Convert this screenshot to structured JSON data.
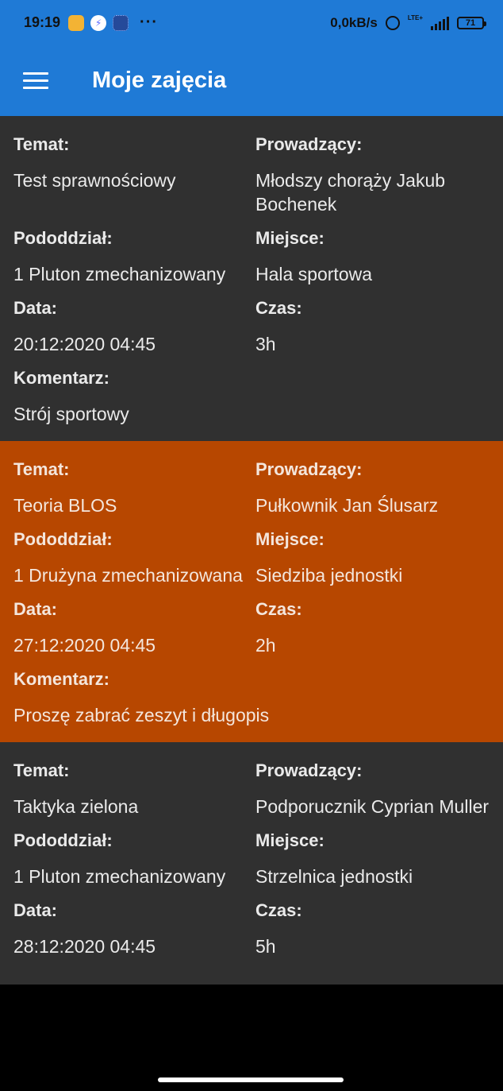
{
  "status_bar": {
    "time": "19:19",
    "speed": "0,0kB/s",
    "network": "LTE+",
    "battery": "71",
    "icons": [
      "notes-icon",
      "messenger-icon",
      "app-icon",
      "more-icon",
      "alarm-icon",
      "signal-icon",
      "battery-icon"
    ]
  },
  "app_bar": {
    "title": "Moje zajęcia"
  },
  "labels": {
    "topic": "Temat:",
    "instructor": "Prowadzący:",
    "unit": "Pododdział:",
    "place": "Miejsce:",
    "date": "Data:",
    "duration": "Czas:",
    "comment": "Komentarz:"
  },
  "classes": [
    {
      "style": "dark",
      "topic": "Test sprawnościowy",
      "instructor": "Młodszy chorąży Jakub Bochenek",
      "unit": "1 Pluton zmechanizowany",
      "place": "Hala sportowa",
      "date": "20:12:2020 04:45",
      "duration": "3h",
      "comment": "Strój sportowy"
    },
    {
      "style": "orange",
      "topic": "Teoria BLOS",
      "instructor": "Pułkownik Jan Ślusarz",
      "unit": "1 Drużyna zmechanizowana",
      "place": "Siedziba jednostki",
      "date": "27:12:2020 04:45",
      "duration": "2h",
      "comment": "Proszę zabrać zeszyt i długopis"
    },
    {
      "style": "dark",
      "topic": "Taktyka zielona",
      "instructor": "Podporucznik Cyprian Muller",
      "unit": "1 Pluton zmechanizowany",
      "place": "Strzelnica jednostki",
      "date": "28:12:2020 04:45",
      "duration": "5h",
      "comment": ""
    }
  ],
  "colors": {
    "primary": "#1f7ad6",
    "card_dark": "#303030",
    "card_highlight": "#b74700"
  }
}
